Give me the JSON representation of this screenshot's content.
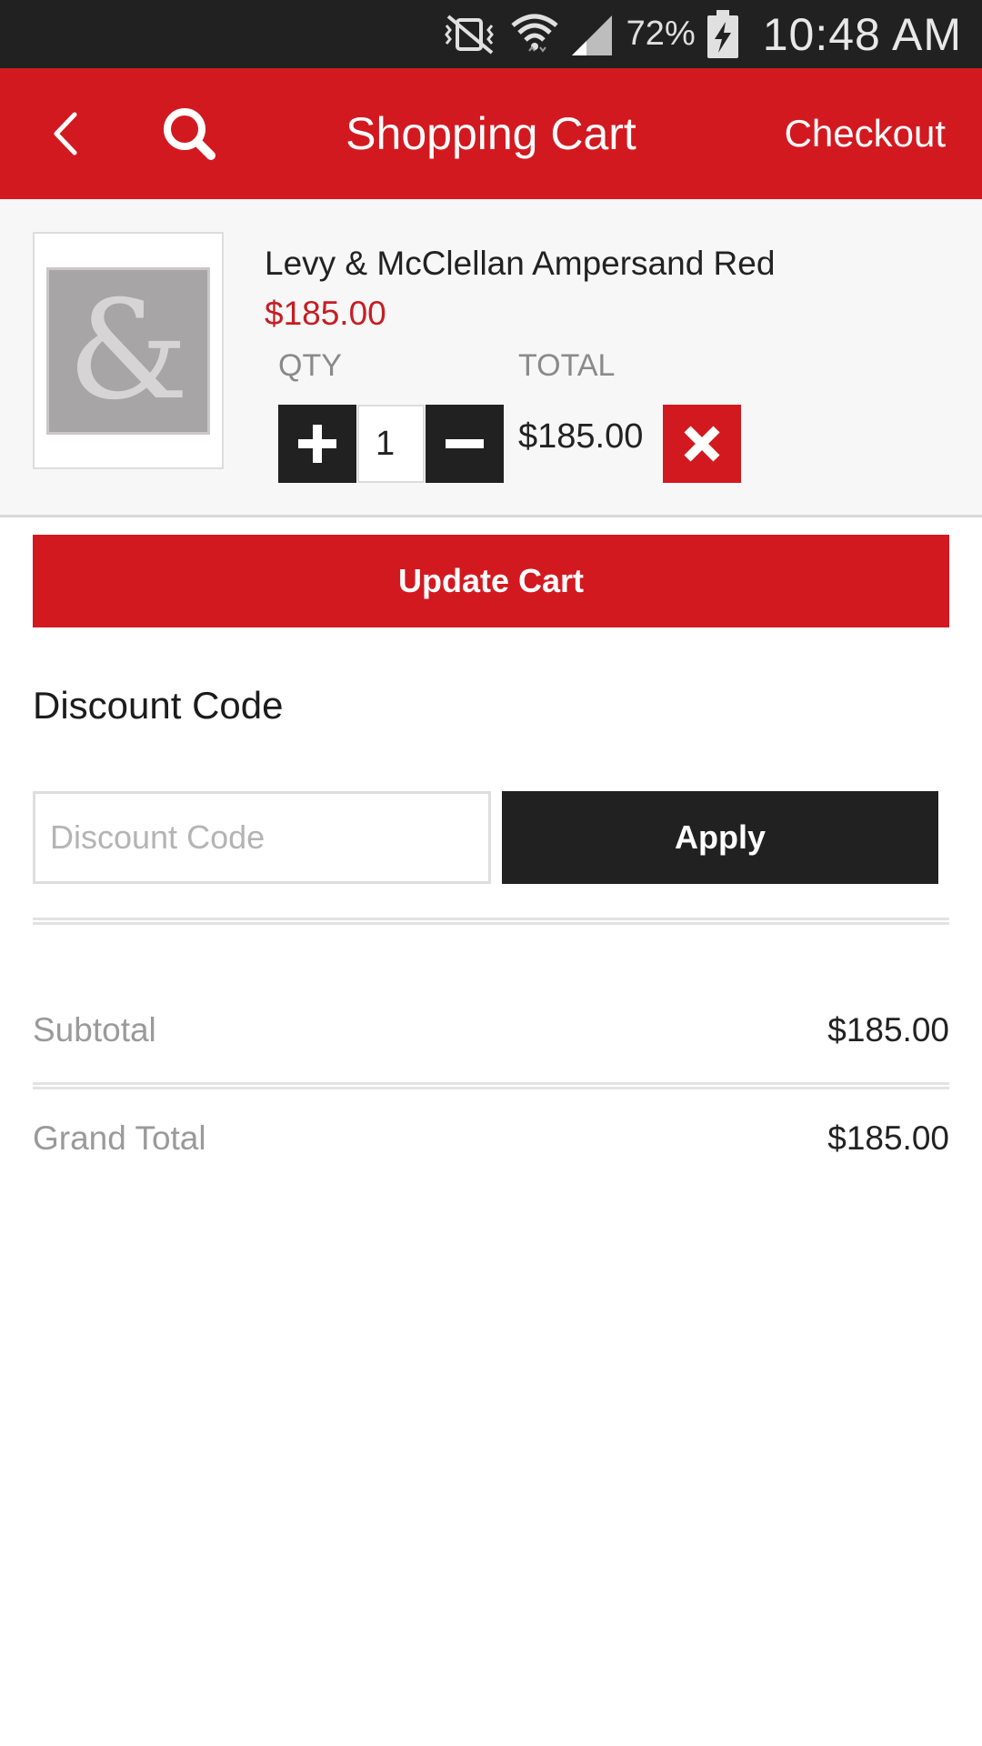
{
  "status_bar": {
    "battery_percent": "72%",
    "time": "10:48 AM",
    "icons": [
      "vibrate-muted-icon",
      "wifi-icon",
      "signal-icon",
      "battery-charging-icon"
    ]
  },
  "app_bar": {
    "title": "Shopping Cart",
    "checkout_label": "Checkout",
    "back_icon": "chevron-left-icon",
    "search_icon": "search-icon",
    "background": "#d31920"
  },
  "cart": {
    "items": [
      {
        "name": "Levy & McClellan Ampersand Red",
        "price": "$185.00",
        "qty_label": "QTY",
        "qty_value": "1",
        "total_label": "TOTAL",
        "total": "$185.00",
        "thumbnail_glyph": "&"
      }
    ],
    "update_button": "Update Cart"
  },
  "discount": {
    "heading": "Discount Code",
    "placeholder": "Discount Code",
    "apply_button": "Apply"
  },
  "summary": {
    "subtotal_label": "Subtotal",
    "subtotal_value": "$185.00",
    "grand_total_label": "Grand Total",
    "grand_total_value": "$185.00"
  },
  "colors": {
    "accent": "#d31920",
    "dark": "#212121",
    "price": "#c61d23"
  }
}
